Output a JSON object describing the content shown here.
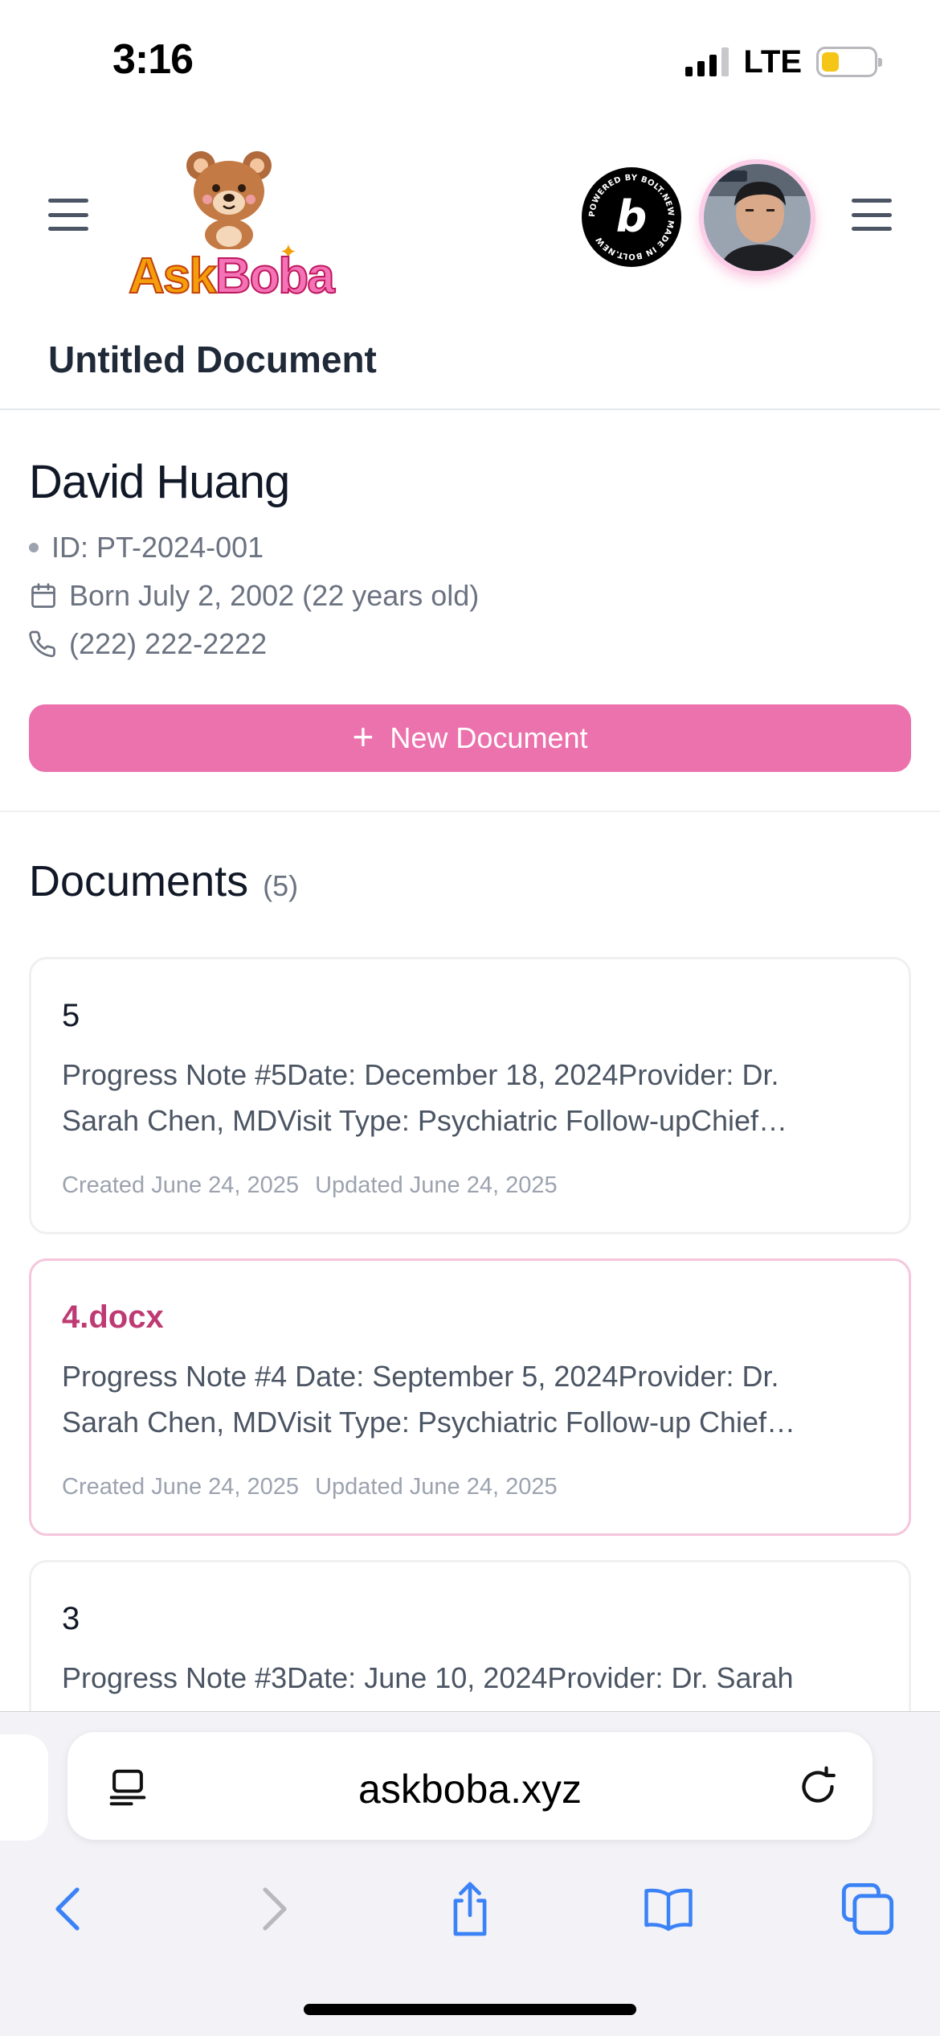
{
  "status_bar": {
    "time": "3:16",
    "network": "LTE",
    "battery_level": 0.3,
    "battery_color": "#f5c518"
  },
  "header": {
    "logo": {
      "word_1": "Ask",
      "word_2": "Boba",
      "icon": "teddy-bear-logo"
    },
    "badge_text": "POWERED BY BOLT.NEW MADE IN BOLT.NEW",
    "badge_letter": "b",
    "left_menu_icon": "hamburger-icon",
    "right_menu_icon": "hamburger-icon",
    "document_title": "Untitled Document"
  },
  "patient": {
    "name": "David Huang",
    "id": "ID: PT-2024-001",
    "born": "Born July 2, 2002 (22 years old)",
    "phone": "(222) 222-2222",
    "new_document_label": "New Document",
    "accent_color": "#ec72ad"
  },
  "documents": {
    "title": "Documents",
    "count": "(5)",
    "items": [
      {
        "name": "5",
        "preview": "Progress Note #5Date: December 18, 2024Provider: Dr. Sarah Chen, MDVisit Type: Psychiatric Follow-upChief Complaint",
        "created": "Created June 24, 2025",
        "updated": "Updated June 24, 2025"
      },
      {
        "name": "4.docx",
        "preview": "Progress Note #4 Date: September 5, 2024Provider: Dr. Sarah Chen, MDVisit Type: Psychiatric Follow-up Chief Complaint",
        "created": "Created June 24, 2025",
        "updated": "Updated June 24, 2025"
      },
      {
        "name": "3",
        "preview": "Progress Note #3Date: June 10, 2024Provider: Dr. Sarah"
      }
    ]
  },
  "browser": {
    "url": "askboba.xyz",
    "buttons": [
      "back-icon",
      "forward-icon",
      "share-icon",
      "bookmarks-icon",
      "tabs-icon"
    ]
  }
}
